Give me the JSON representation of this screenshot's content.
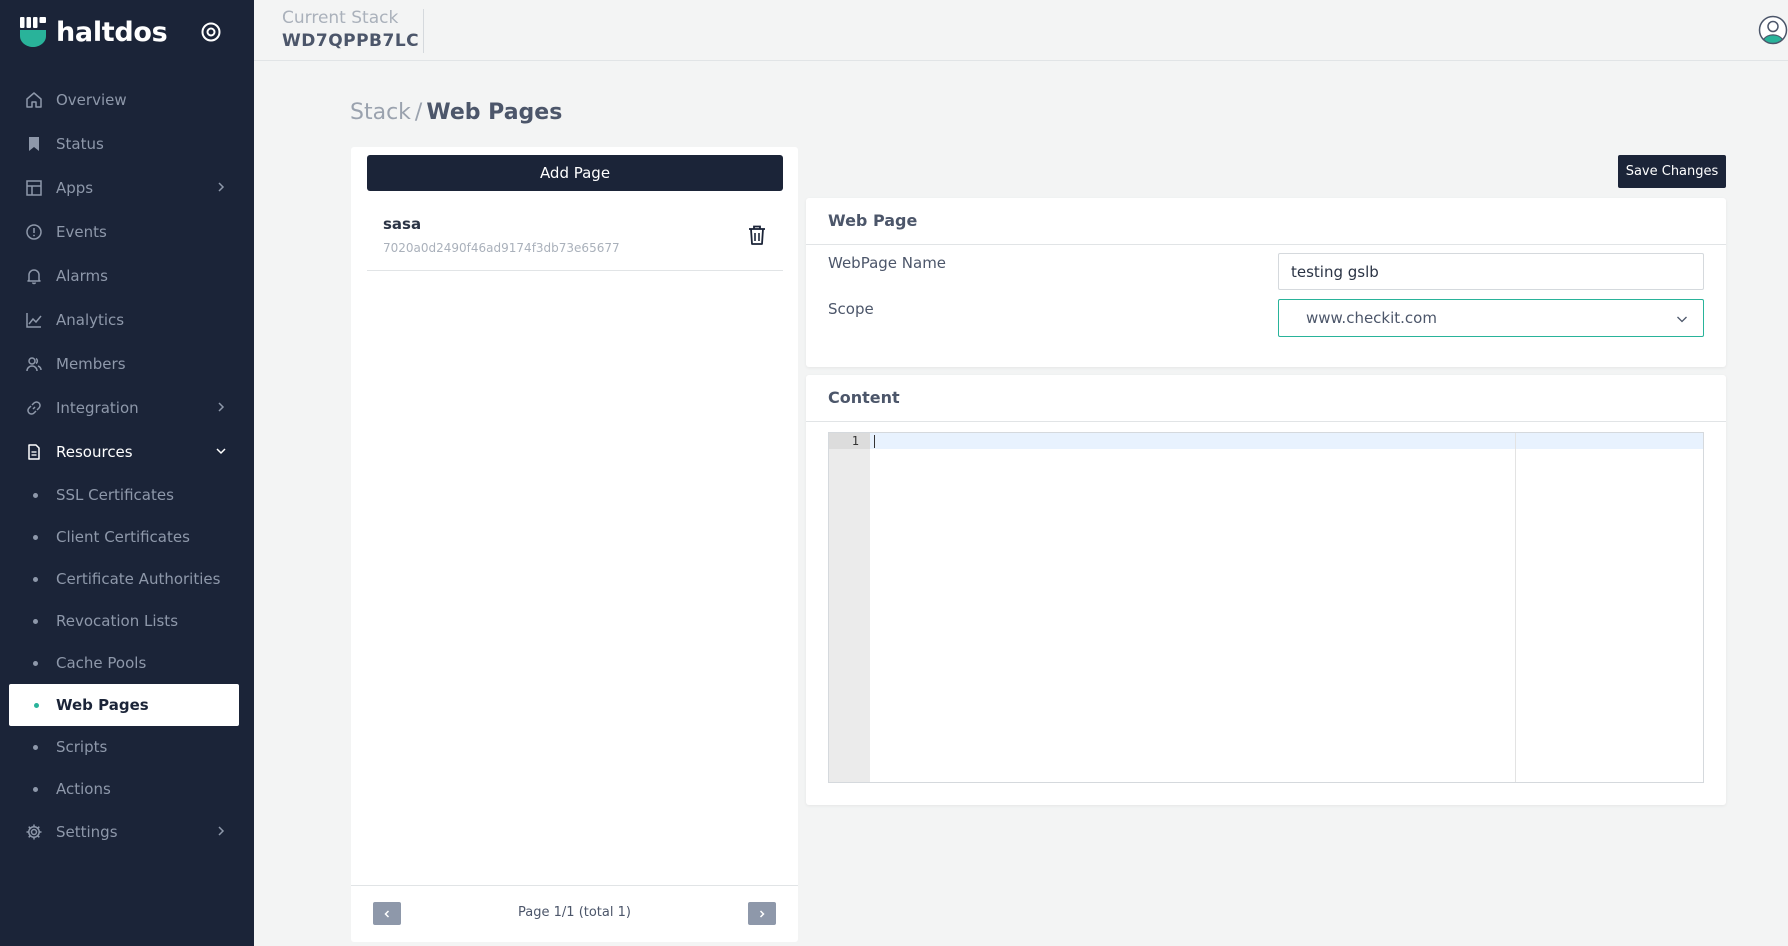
{
  "brand": {
    "name": "haltdos"
  },
  "topbar": {
    "stack_label": "Current Stack",
    "stack_id": "WD7QPPB7LC"
  },
  "nav": {
    "items": [
      {
        "label": "Overview",
        "icon": "home-icon"
      },
      {
        "label": "Status",
        "icon": "bookmark-icon"
      },
      {
        "label": "Apps",
        "icon": "layout-icon",
        "chevron": "right"
      },
      {
        "label": "Events",
        "icon": "alert-circle-icon"
      },
      {
        "label": "Alarms",
        "icon": "bell-icon"
      },
      {
        "label": "Analytics",
        "icon": "line-chart-icon"
      },
      {
        "label": "Members",
        "icon": "users-icon"
      },
      {
        "label": "Integration",
        "icon": "link-icon",
        "chevron": "right"
      },
      {
        "label": "Resources",
        "icon": "document-icon",
        "chevron": "down"
      }
    ],
    "sub_items": [
      {
        "label": "SSL Certificates"
      },
      {
        "label": "Client Certificates"
      },
      {
        "label": "Certificate Authorities"
      },
      {
        "label": "Revocation Lists"
      },
      {
        "label": "Cache Pools"
      },
      {
        "label": "Web Pages",
        "active": true
      },
      {
        "label": "Scripts"
      },
      {
        "label": "Actions"
      }
    ],
    "settings": {
      "label": "Settings",
      "icon": "gear-icon",
      "chevron": "right"
    }
  },
  "breadcrumb": {
    "root": "Stack",
    "separator": "/",
    "current": "Web Pages"
  },
  "list": {
    "add_label": "Add Page",
    "pages": [
      {
        "name": "sasa",
        "id": "7020a0d2490f46ad9174f3db73e65677"
      }
    ],
    "pagination": "Page 1/1 (total 1)"
  },
  "save_label": "Save Changes",
  "webpage_card": {
    "title": "Web Page",
    "name_label": "WebPage Name",
    "name_value": "testing gslb",
    "scope_label": "Scope",
    "scope_value": "www.checkit.com"
  },
  "content_card": {
    "title": "Content",
    "line_number": "1"
  },
  "colors": {
    "sidebar": "#1b2438",
    "accent": "#29b39a",
    "background": "#f3f4f4"
  }
}
